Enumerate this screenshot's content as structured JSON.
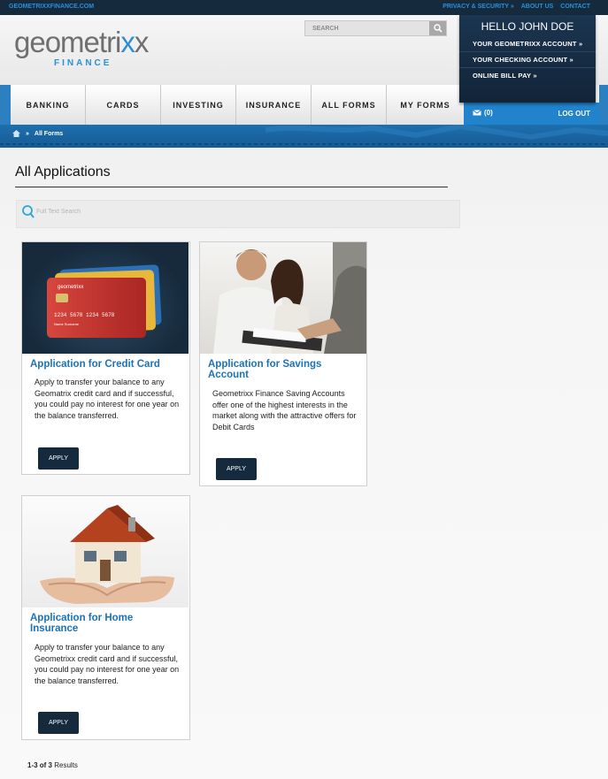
{
  "topbar": {
    "site": "GEOMETRIXXFINANCE.COM",
    "links": [
      "PRIVACY & SECURITY »",
      "ABOUT US",
      "CONTACT"
    ]
  },
  "logo": {
    "word_main": "geometri",
    "word_accent": "x",
    "word_end": "x",
    "subtitle": "FINANCE"
  },
  "search": {
    "placeholder": "SEARCH"
  },
  "user": {
    "greeting": "HELLO JOHN DOE",
    "links": [
      "YOUR GEOMETRIXX ACCOUNT »",
      "YOUR CHECKING ACCOUNT »",
      "ONLINE BILL PAY »"
    ],
    "mail_count": "(0)",
    "logout": "LOG OUT"
  },
  "nav": {
    "items": [
      "BANKING",
      "CARDS",
      "INVESTING",
      "INSURANCE",
      "ALL FORMS",
      "MY FORMS"
    ]
  },
  "breadcrumb": {
    "separator": "»",
    "current": "All Forms"
  },
  "page": {
    "title": "All Applications",
    "fts_placeholder": "Full Text Search",
    "results_range": "1-3 of 3",
    "results_label": "Results"
  },
  "cards": [
    {
      "title": "Application for Credit Card",
      "description": "Apply to transfer your balance to any Geomatrix credit card and if successful, you could pay no interest for one year on the balance transferred.",
      "button": "APPLY",
      "image": "credit-cards-image"
    },
    {
      "title": "Application for Savings Account",
      "description": "Geometrixx Finance Saving Accounts offer one of the highest interests in the market along with the attractive offers for Debit Cards",
      "button": "APPLY",
      "image": "couple-signing-image"
    },
    {
      "title": "Application for Home Insurance",
      "description": "Apply to transfer your balance to any Geometrixx credit card and if successful, you could pay no interest for one year on the balance transferred.",
      "button": "APPLY",
      "image": "house-in-hands-image"
    }
  ],
  "colors": {
    "brand_blue": "#1b72b8",
    "dark_navy": "#152a3d",
    "nav_blue": "#2083cc"
  }
}
